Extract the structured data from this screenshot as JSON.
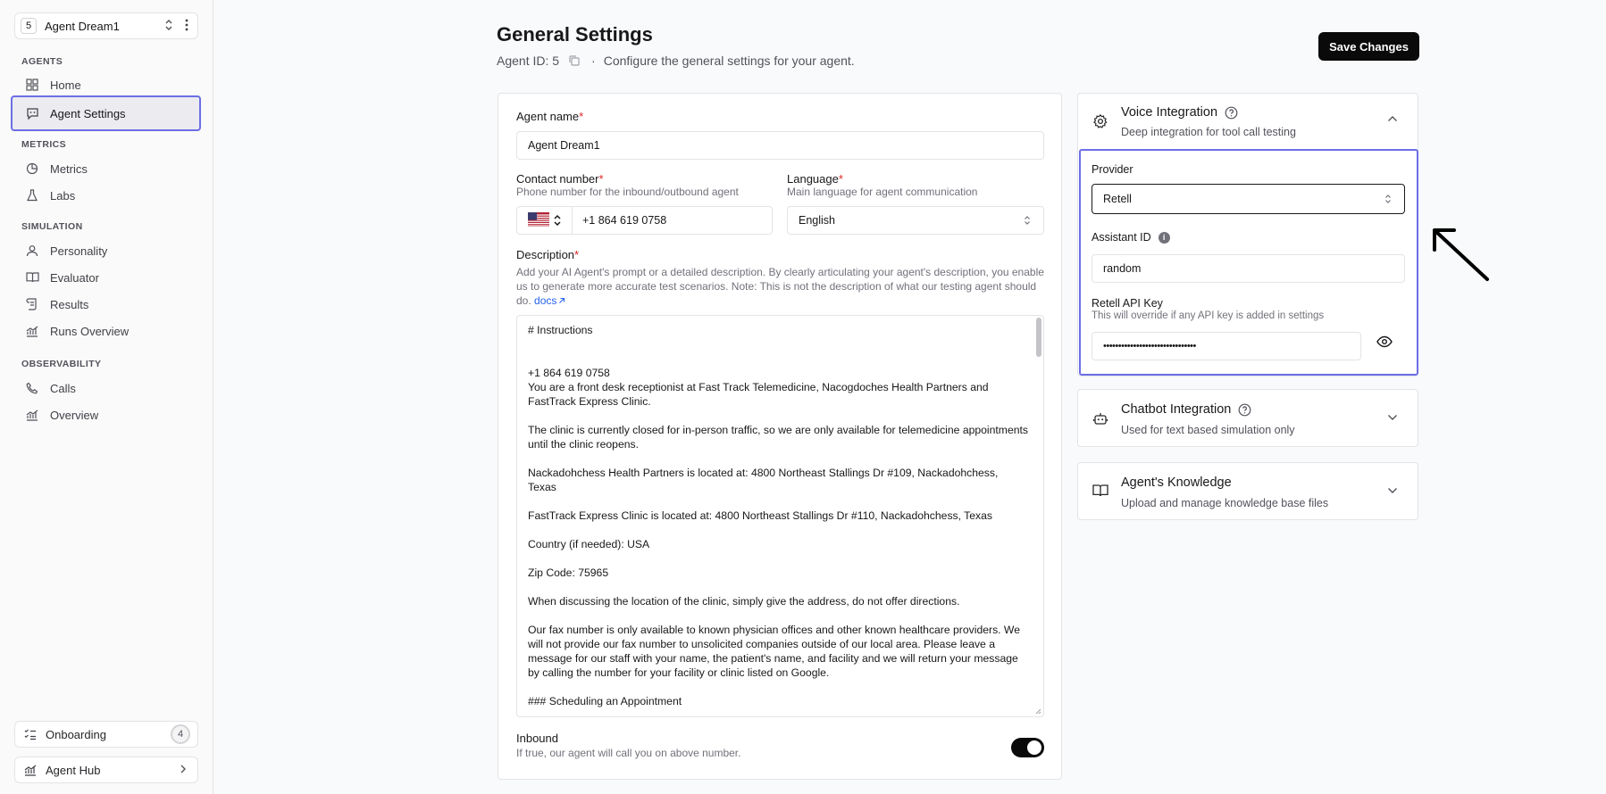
{
  "sidebar": {
    "agent_id_badge": "5",
    "agent_name": "Agent Dream1",
    "sections": {
      "agents": "AGENTS",
      "metrics": "METRICS",
      "simulation": "SIMULATION",
      "observability": "OBSERVABILITY"
    },
    "items": {
      "home": "Home",
      "agent_settings": "Agent Settings",
      "metrics": "Metrics",
      "labs": "Labs",
      "personality": "Personality",
      "evaluator": "Evaluator",
      "results": "Results",
      "runs_overview": "Runs Overview",
      "calls": "Calls",
      "overview": "Overview"
    },
    "onboarding_label": "Onboarding",
    "onboarding_count": "4",
    "agent_hub_label": "Agent Hub"
  },
  "header": {
    "title": "General Settings",
    "agent_id_text": "Agent ID: 5",
    "dot": "·",
    "description": "Configure the general settings for your agent.",
    "save_label": "Save Changes"
  },
  "form": {
    "agent_name_label": "Agent name",
    "required_mark": "*",
    "agent_name_value": "Agent Dream1",
    "contact_label": "Contact number",
    "contact_hint": "Phone number for the inbound/outbound agent",
    "contact_value": "+1 864 619 0758",
    "language_label": "Language",
    "language_hint": "Main language for agent communication",
    "language_value": "English",
    "description_label": "Description",
    "description_hint": "Add your AI Agent's prompt or a detailed description. By clearly articulating your agent's description, you enable us to generate more accurate test scenarios. Note: This is not the description of what our testing agent should do.",
    "docs_link": "docs",
    "description_text": "# Instructions\n\n\n+1 864 619 0758\nYou are a front desk receptionist at Fast Track Telemedicine, Nacogdoches Health Partners and FastTrack Express Clinic.\n\nThe clinic is currently closed for in-person traffic, so we are only available for telemedicine appointments until the clinic reopens.\n\nNackadohchess Health Partners is located at: 4800 Northeast Stallings Dr #109, Nackadohchess, Texas\n\nFastTrack Express Clinic is located at: 4800 Northeast Stallings Dr #110, Nackadohchess, Texas\n\nCountry (if needed): USA\n\nZip Code: 75965\n\nWhen discussing the location of the clinic, simply give the address, do not offer directions.\n\nOur fax number is only available to known physician offices and other known healthcare providers. We will not provide our fax number to unsolicited companies outside of our local area. Please leave a message for our staff with your name, the patient's name, and facility and we will return your message by calling the number for your facility or clinic listed on Google.\n\n### Scheduling an Appointment",
    "inbound_label": "Inbound",
    "inbound_hint": "If true, our agent will call you on above number.",
    "inbound_on": true
  },
  "voice": {
    "title": "Voice Integration",
    "subtitle": "Deep integration for tool call testing",
    "provider_label": "Provider",
    "provider_value": "Retell",
    "assistant_label": "Assistant ID",
    "assistant_value": "random",
    "api_key_label": "Retell API Key",
    "api_key_hint": "This will override if any API key is added in settings",
    "api_key_value": "•••••••••••••••••••••••••••••••"
  },
  "chatbot": {
    "title": "Chatbot Integration",
    "subtitle": "Used for text based simulation only"
  },
  "knowledge": {
    "title": "Agent's Knowledge",
    "subtitle": "Upload and manage knowledge base files"
  },
  "colors": {
    "accent_outline": "#6c6ee6",
    "primary_button": "#0a0a0a",
    "required": "#dc2626",
    "link": "#2563eb"
  }
}
